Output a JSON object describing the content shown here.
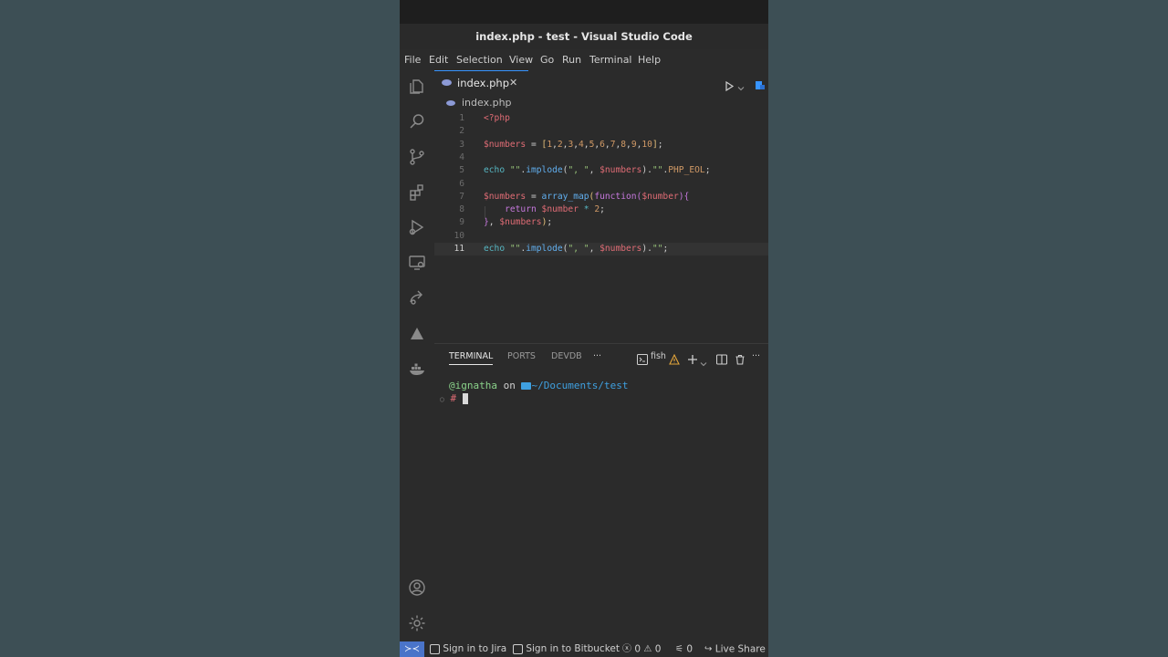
{
  "window": {
    "title": "index.php - test - Visual Studio Code"
  },
  "menu": [
    "File",
    "Edit",
    "Selection",
    "View",
    "Go",
    "Run",
    "Terminal",
    "Help"
  ],
  "tab": {
    "label": "index.php",
    "close": "✕"
  },
  "breadcrumb": "index.php",
  "editor": {
    "lines": [
      {
        "n": "1",
        "tokens": [
          {
            "t": "<?php",
            "c": "#e06c75"
          }
        ]
      },
      {
        "n": "2",
        "tokens": []
      },
      {
        "n": "3",
        "tokens": [
          {
            "t": "$numbers",
            "c": "#e06c75"
          },
          {
            "t": " = ",
            "c": "#cfcfcf"
          },
          {
            "t": "[",
            "c": "#e5c07b"
          },
          {
            "t": "1",
            "c": "#d19a66"
          },
          {
            "t": ",",
            "c": "#cfcfcf"
          },
          {
            "t": "2",
            "c": "#d19a66"
          },
          {
            "t": ",",
            "c": "#cfcfcf"
          },
          {
            "t": "3",
            "c": "#d19a66"
          },
          {
            "t": ",",
            "c": "#cfcfcf"
          },
          {
            "t": "4",
            "c": "#d19a66"
          },
          {
            "t": ",",
            "c": "#cfcfcf"
          },
          {
            "t": "5",
            "c": "#d19a66"
          },
          {
            "t": ",",
            "c": "#cfcfcf"
          },
          {
            "t": "6",
            "c": "#d19a66"
          },
          {
            "t": ",",
            "c": "#cfcfcf"
          },
          {
            "t": "7",
            "c": "#d19a66"
          },
          {
            "t": ",",
            "c": "#cfcfcf"
          },
          {
            "t": "8",
            "c": "#d19a66"
          },
          {
            "t": ",",
            "c": "#cfcfcf"
          },
          {
            "t": "9",
            "c": "#d19a66"
          },
          {
            "t": ",",
            "c": "#cfcfcf"
          },
          {
            "t": "10",
            "c": "#d19a66"
          },
          {
            "t": "]",
            "c": "#e5c07b"
          },
          {
            "t": ";",
            "c": "#cfcfcf"
          }
        ]
      },
      {
        "n": "4",
        "tokens": []
      },
      {
        "n": "5",
        "tokens": [
          {
            "t": "echo ",
            "c": "#56b6c2"
          },
          {
            "t": "\"\"",
            "c": "#98c379"
          },
          {
            "t": ".",
            "c": "#cfcfcf"
          },
          {
            "t": "implode",
            "c": "#61afef"
          },
          {
            "t": "(",
            "c": "#cfcfcf"
          },
          {
            "t": "\", \"",
            "c": "#98c379"
          },
          {
            "t": ", ",
            "c": "#cfcfcf"
          },
          {
            "t": "$numbers",
            "c": "#e06c75"
          },
          {
            "t": ").",
            "c": "#cfcfcf"
          },
          {
            "t": "\"\"",
            "c": "#98c379"
          },
          {
            "t": ".",
            "c": "#cfcfcf"
          },
          {
            "t": "PHP_EOL",
            "c": "#d19a66"
          },
          {
            "t": ";",
            "c": "#cfcfcf"
          }
        ]
      },
      {
        "n": "6",
        "tokens": []
      },
      {
        "n": "7",
        "tokens": [
          {
            "t": "$numbers",
            "c": "#e06c75"
          },
          {
            "t": " = ",
            "c": "#cfcfcf"
          },
          {
            "t": "array_map",
            "c": "#61afef"
          },
          {
            "t": "(",
            "c": "#e5c07b"
          },
          {
            "t": "function",
            "c": "#c678dd"
          },
          {
            "t": "(",
            "c": "#c678dd"
          },
          {
            "t": "$number",
            "c": "#e06c75"
          },
          {
            "t": "){",
            "c": "#c678dd"
          }
        ]
      },
      {
        "n": "8",
        "tokens": [
          {
            "t": "    return ",
            "c": "#c678dd"
          },
          {
            "t": "$number",
            "c": "#e06c75"
          },
          {
            "t": " * ",
            "c": "#56b6c2"
          },
          {
            "t": "2",
            "c": "#d19a66"
          },
          {
            "t": ";",
            "c": "#cfcfcf"
          }
        ]
      },
      {
        "n": "9",
        "tokens": [
          {
            "t": "}",
            "c": "#c678dd"
          },
          {
            "t": ", ",
            "c": "#cfcfcf"
          },
          {
            "t": "$numbers",
            "c": "#e06c75"
          },
          {
            "t": ")",
            "c": "#e5c07b"
          },
          {
            "t": ";",
            "c": "#cfcfcf"
          }
        ]
      },
      {
        "n": "10",
        "tokens": []
      },
      {
        "n": "11",
        "tokens": [
          {
            "t": "echo ",
            "c": "#56b6c2"
          },
          {
            "t": "\"\"",
            "c": "#98c379"
          },
          {
            "t": ".",
            "c": "#cfcfcf"
          },
          {
            "t": "implode",
            "c": "#61afef"
          },
          {
            "t": "(",
            "c": "#cfcfcf"
          },
          {
            "t": "\", \"",
            "c": "#98c379"
          },
          {
            "t": ", ",
            "c": "#cfcfcf"
          },
          {
            "t": "$numbers",
            "c": "#e06c75"
          },
          {
            "t": ").",
            "c": "#cfcfcf"
          },
          {
            "t": "\"\"",
            "c": "#98c379"
          },
          {
            "t": ";",
            "c": "#cfcfcf"
          }
        ]
      }
    ]
  },
  "panel": {
    "tabs": [
      "TERMINAL",
      "PORTS",
      "DEVDB"
    ],
    "more": "···",
    "shell": "fish",
    "terminal": {
      "user": "ignatha",
      "on": "on",
      "path": "~/Documents/test",
      "prompt": "#"
    }
  },
  "status": {
    "jira": "Sign in to Jira",
    "bitbucket": "Sign in to Bitbucket",
    "errors": "0",
    "warnings": "0",
    "ports": "0",
    "liveshare": "Live Share"
  },
  "colors": {
    "accent": "#3794ff",
    "remote": "#4a74c9",
    "terminal_user": "#8ad28a",
    "folder": "#3fa0e0"
  }
}
